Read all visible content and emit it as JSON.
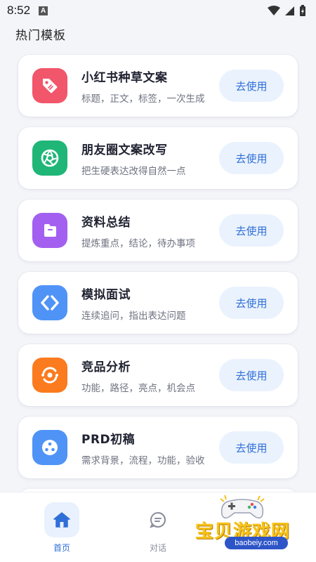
{
  "status_bar": {
    "time": "8:52",
    "notification_letter": "A"
  },
  "section_title": "热门模板",
  "templates": [
    {
      "title": "小红书种草文案",
      "subtitle": "标题，正文，标签，一次生成",
      "button": "去使用",
      "icon": "tag-icon",
      "color": "#f1566a"
    },
    {
      "title": "朋友圈文案改写",
      "subtitle": "把生硬表达改得自然一点",
      "button": "去使用",
      "icon": "aperture-icon",
      "color": "#1fb677"
    },
    {
      "title": "资料总结",
      "subtitle": "提炼重点，结论，待办事项",
      "button": "去使用",
      "icon": "folder-icon",
      "color": "#a35ff0"
    },
    {
      "title": "模拟面试",
      "subtitle": "连续追问，指出表达问题",
      "button": "去使用",
      "icon": "code-brackets-icon",
      "color": "#4f93f7"
    },
    {
      "title": "竞品分析",
      "subtitle": "功能，路径，亮点，机会点",
      "button": "去使用",
      "icon": "sync-circle-icon",
      "color": "#fb7b1e"
    },
    {
      "title": "PRD初稿",
      "subtitle": "需求背景，流程，功能，验收",
      "button": "去使用",
      "icon": "dots-circle-icon",
      "color": "#4f93f7"
    }
  ],
  "nav": {
    "home": "首页",
    "chat": "对话"
  },
  "watermark": {
    "text": "宝贝游戏网",
    "url": "baobeiy.com"
  },
  "colors": {
    "accent": "#2f6fd8",
    "button_bg": "#eaf2fd",
    "background": "#f4f5f9"
  }
}
